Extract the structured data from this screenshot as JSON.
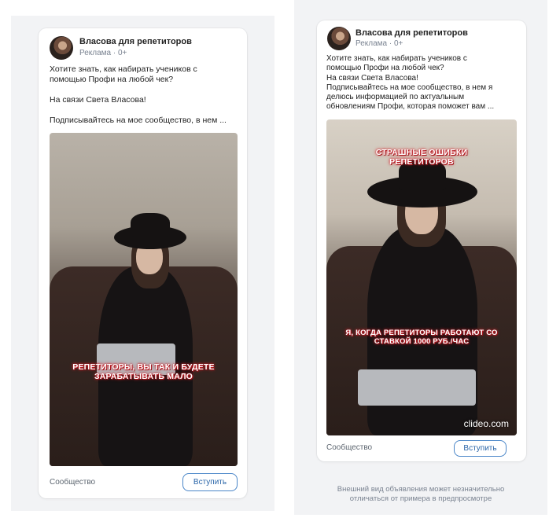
{
  "previews": [
    {
      "author": "Власова для репетиторов",
      "ad_label": "Реклама · 0+",
      "text_lines": [
        "Хотите знать, как набирать учеников с",
        "помощью Профи на любой чек?",
        "",
        "На связи Света Власова!",
        "",
        "Подписывайтесь на мое сообщество, в нем ..."
      ],
      "video_caption_lines": [
        "РЕПЕТИТОРЫ, ВЫ ТАК И БУДЕТЕ",
        "ЗАРАБАТЫВАТЬ МАЛО"
      ],
      "footer_label": "Сообщество",
      "join_button": "Вступить"
    },
    {
      "author": "Власова для репетиторов",
      "ad_label": "Реклама · 0+",
      "text_lines": [
        "Хотите знать, как набирать учеников с",
        "помощью Профи на любой чек?",
        "На связи Света Власова!",
        "Подписывайтесь на мое сообщество, в нем я",
        "делюсь информацией по актуальным",
        "обновлениям Профи, которая поможет вам ..."
      ],
      "video_top_caption_lines": [
        "СТРАШНЫЕ ОШИБКИ",
        "РЕПЕТИТОРОВ"
      ],
      "video_caption_lines": [
        "Я, КОГДА РЕПЕТИТОРЫ РАБОТАЮТ СО",
        "СТАВКОЙ 1000 РУБ./ЧАС"
      ],
      "watermark": "clideo.com",
      "footer_label": "Сообщество",
      "join_button": "Вступить"
    }
  ],
  "disclaimer_lines": [
    "Внешний вид объявления может незначительно",
    "отличаться от примера в предпросмотре"
  ],
  "colors": {
    "background_panel": "#f2f3f5",
    "button_border": "#4a86c8",
    "button_text": "#2a65a8",
    "caption_glow": "#d0202a"
  }
}
